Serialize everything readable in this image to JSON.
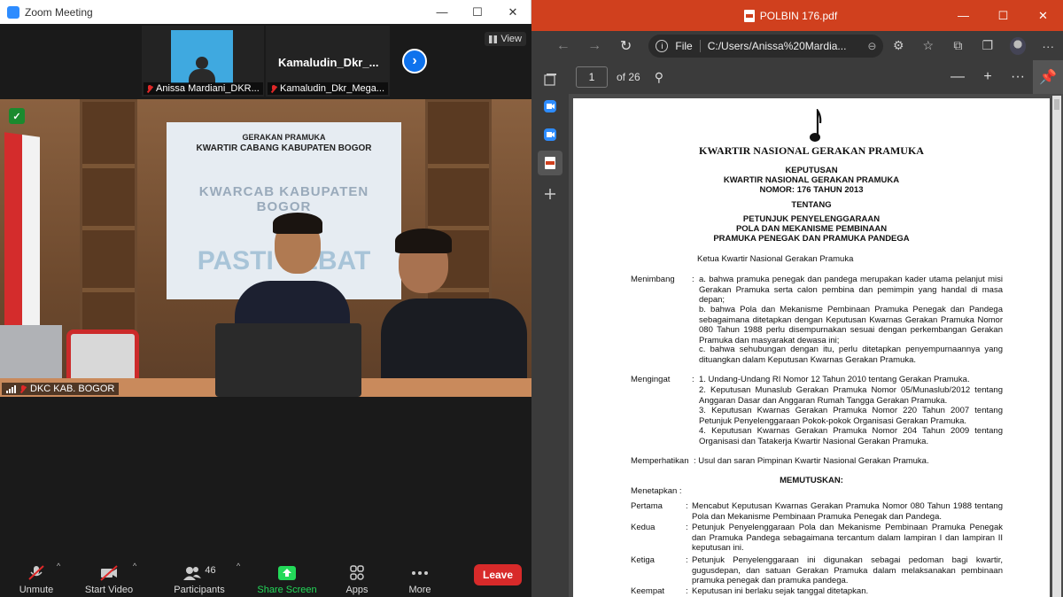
{
  "zoom": {
    "window_title": "Zoom Meeting",
    "view_label": "View",
    "participants": [
      {
        "name": "Anissa Mardiani_DKR..."
      },
      {
        "name": "Kamaludin_Dkr_Mega...",
        "display_name": "Kamaludin_Dkr_..."
      }
    ],
    "active_speaker": "DKC KAB. BOGOR",
    "banner": {
      "line1": "GERAKAN PRAMUKA",
      "line2": "KWARTIR CABANG KABUPATEN BOGOR",
      "arc": "KWARCAB KABUPATEN BOGOR",
      "big": "PASTI HEBAT"
    },
    "toolbar": {
      "unmute": "Unmute",
      "start_video": "Start Video",
      "participants": "Participants",
      "participants_count": "46",
      "share_screen": "Share Screen",
      "apps": "Apps",
      "more": "More",
      "leave": "Leave"
    },
    "colors": {
      "accent": "#0e72ed",
      "share": "#23d959",
      "leave": "#d82a2a",
      "muted": "#e02828"
    }
  },
  "pdf": {
    "window_title": "POLBIN 176.pdf",
    "file_label": "File",
    "url": "C:/Users/Anissa%20Mardia...",
    "page_current": "1",
    "page_total": "of 26",
    "doc": {
      "org": "KWARTIR NASIONAL GERAKAN PRAMUKA",
      "keputusan": "KEPUTUSAN",
      "issuer": "KWARTIR NASIONAL GERAKAN PRAMUKA",
      "nomor": "NOMOR: 176 TAHUN 2013",
      "tentang": "TENTANG",
      "subj1": "PETUNJUK PENYELENGGARAAN",
      "subj2": "POLA DAN MEKANISME PEMBINAAN",
      "subj3": "PRAMUKA PENEGAK DAN PRAMUKA PANDEGA",
      "ketua": "Ketua Kwartir Nasional Gerakan Pramuka",
      "menimbang_label": "Menimbang",
      "menimbang": [
        "a. bahwa pramuka penegak dan pandega merupakan kader utama pelanjut misi Gerakan Pramuka serta calon pembina dan pemimpin yang handal di masa depan;",
        "b. bahwa Pola dan Mekanisme Pembinaan Pramuka Penegak dan Pandega sebagaimana ditetapkan dengan Keputusan Kwarnas Gerakan Pramuka Nomor 080 Tahun 1988 perlu disempurnakan sesuai dengan perkembangan Gerakan Pramuka dan masyarakat dewasa ini;",
        "c. bahwa sehubungan dengan itu, perlu ditetapkan penyempurnaannya yang dituangkan dalam Keputusan Kwarnas Gerakan Pramuka."
      ],
      "mengingat_label": "Mengingat",
      "mengingat": [
        "1. Undang-Undang RI Nomor 12 Tahun 2010 tentang Gerakan Pramuka.",
        "2. Keputusan Munaslub Gerakan Pramuka Nomor 05/Munaslub/2012 tentang Anggaran Dasar dan Anggaran Rumah Tangga Gerakan Pramuka.",
        "3. Keputusan Kwarnas Gerakan Pramuka Nomor 220 Tahun 2007 tentang Petunjuk Penyelenggaraan Pokok-pokok Organisasi Gerakan Pramuka.",
        "4. Keputusan Kwarnas Gerakan Pramuka Nomor 204 Tahun 2009 tentang Organisasi dan Tatakerja Kwartir Nasional Gerakan Pramuka."
      ],
      "memperhatikan_label": "Memperhatikan",
      "memperhatikan": ": Usul dan saran Pimpinan Kwartir Nasional Gerakan Pramuka.",
      "memutuskan": "MEMUTUSKAN:",
      "menetapkan": "Menetapkan  :",
      "pertama_label": "Pertama",
      "pertama": "Mencabut Keputusan Kwarnas Gerakan Pramuka Nomor 080 Tahun 1988 tentang Pola dan Mekanisme Pembinaan Pramuka Penegak dan Pandega.",
      "kedua_label": "Kedua",
      "kedua": "Petunjuk Penyelenggaraan Pola dan Mekanisme Pembinaan Pramuka Penegak dan Pramuka Pandega sebagaimana tercantum dalam lampiran I dan lampiran II keputusan ini.",
      "ketiga_label": "Ketiga",
      "ketiga": "Petunjuk Penyelenggaraan ini digunakan sebagai pedoman bagi kwartir, gugusdepan, dan satuan Gerakan Pramuka dalam melaksanakan pembinaan pramuka penegak dan pramuka pandega.",
      "keempat_label": "Keempat",
      "keempat": "Keputusan ini berlaku sejak tanggal ditetapkan."
    }
  }
}
